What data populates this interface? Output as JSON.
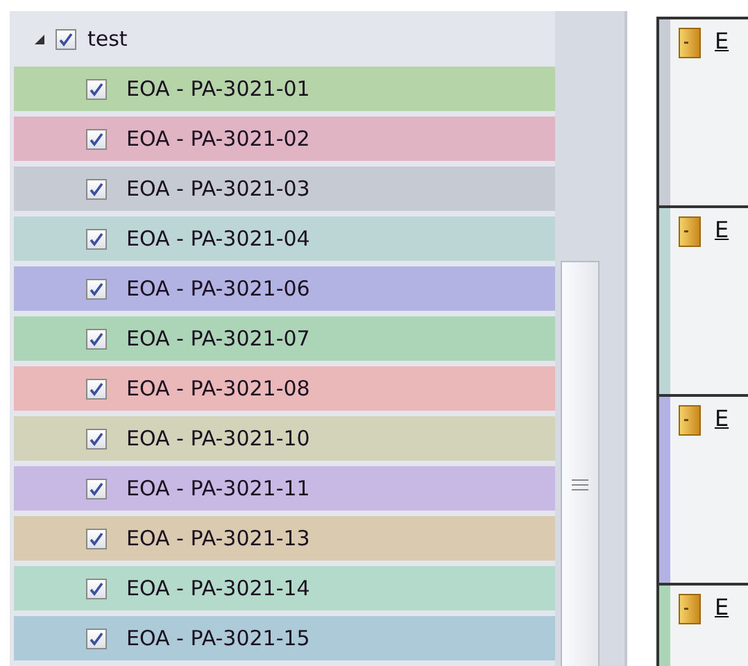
{
  "tree": {
    "label": "test",
    "expanded": true,
    "checked": true,
    "children": [
      {
        "label": "EOA - PA-3021-01",
        "checked": true,
        "color": "#b5d5a8"
      },
      {
        "label": "EOA - PA-3021-02",
        "checked": true,
        "color": "#e0b4c2"
      },
      {
        "label": "EOA - PA-3021-03",
        "checked": true,
        "color": "#c6cad3"
      },
      {
        "label": "EOA - PA-3021-04",
        "checked": true,
        "color": "#bcd6d6"
      },
      {
        "label": "EOA - PA-3021-06",
        "checked": true,
        "color": "#b2b3e2"
      },
      {
        "label": "EOA - PA-3021-07",
        "checked": true,
        "color": "#acd5b8"
      },
      {
        "label": "EOA - PA-3021-08",
        "checked": true,
        "color": "#eab8b8"
      },
      {
        "label": "EOA - PA-3021-10",
        "checked": true,
        "color": "#d3d3ba"
      },
      {
        "label": "EOA - PA-3021-11",
        "checked": true,
        "color": "#c8b8e4"
      },
      {
        "label": "EOA - PA-3021-13",
        "checked": true,
        "color": "#dacab0"
      },
      {
        "label": "EOA - PA-3021-14",
        "checked": true,
        "color": "#b3dacb"
      },
      {
        "label": "EOA - PA-3021-15",
        "checked": true,
        "color": "#adcad8"
      }
    ]
  },
  "cards": [
    {
      "title": "E",
      "color": "#c8ccd4"
    },
    {
      "title": "E",
      "color": "#bcd6d6"
    },
    {
      "title": "E",
      "color": "#b2b3e2"
    },
    {
      "title": "E",
      "color": "#acd5b8"
    }
  ]
}
